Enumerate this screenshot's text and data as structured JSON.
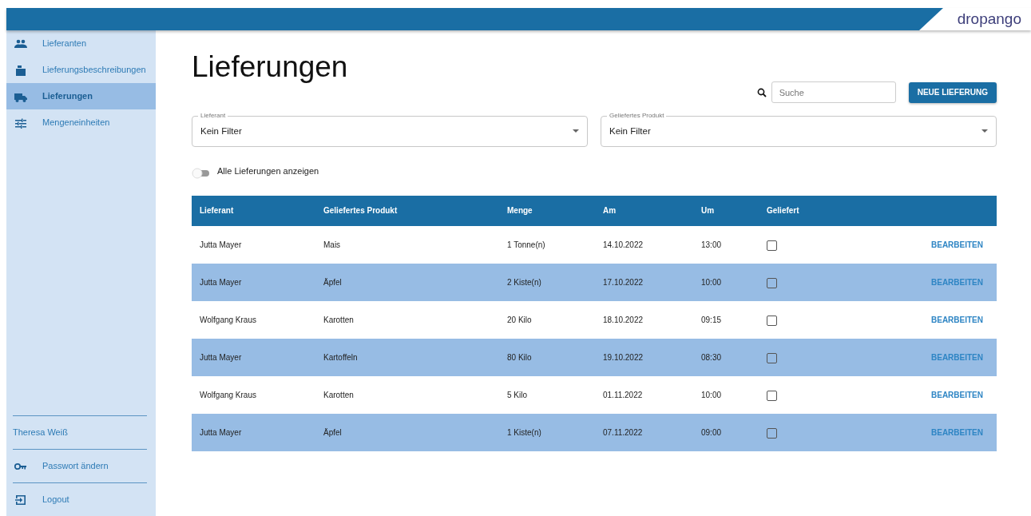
{
  "header": {
    "logo": "dropango"
  },
  "sidebar": {
    "items": [
      {
        "label": "Lieferanten",
        "selected": false
      },
      {
        "label": "Lieferungsbeschreibungen",
        "selected": false
      },
      {
        "label": "Lieferungen",
        "selected": true
      },
      {
        "label": "Mengeneinheiten",
        "selected": false
      }
    ],
    "user": "Theresa Weiß",
    "footer_items": [
      {
        "label": "Passwort ändern"
      },
      {
        "label": "Logout"
      }
    ]
  },
  "page_title": "Lieferungen",
  "search": {
    "placeholder": "Suche"
  },
  "new_button": "NEUE LIEFERUNG",
  "filters": [
    {
      "label": "Lieferant",
      "value": "Kein Filter"
    },
    {
      "label": "Geliefertes Produkt",
      "value": "Kein Filter"
    }
  ],
  "toggle": {
    "label": "Alle Lieferungen anzeigen",
    "on": false
  },
  "table": {
    "columns": [
      "Lieferant",
      "Geliefertes Produkt",
      "Menge",
      "Am",
      "Um",
      "Geliefert"
    ],
    "rows": [
      {
        "cells": [
          "Jutta Mayer",
          "Mais",
          "1 Tonne(n)",
          "14.10.2022",
          "13:00"
        ],
        "delivered": false,
        "action": "BEARBEITEN"
      },
      {
        "cells": [
          "Jutta Mayer",
          "Äpfel",
          "2 Kiste(n)",
          "17.10.2022",
          "10:00"
        ],
        "delivered": false,
        "action": "BEARBEITEN"
      },
      {
        "cells": [
          "Wolfgang Kraus",
          "Karotten",
          "20 Kilo",
          "18.10.2022",
          "09:15"
        ],
        "delivered": false,
        "action": "BEARBEITEN"
      },
      {
        "cells": [
          "Jutta Mayer",
          "Kartoffeln",
          "80 Kilo",
          "19.10.2022",
          "08:30"
        ],
        "delivered": false,
        "action": "BEARBEITEN"
      },
      {
        "cells": [
          "Wolfgang Kraus",
          "Karotten",
          "5 Kilo",
          "01.11.2022",
          "10:00"
        ],
        "delivered": false,
        "action": "BEARBEITEN"
      },
      {
        "cells": [
          "Jutta Mayer",
          "Äpfel",
          "1 Kiste(n)",
          "07.11.2022",
          "09:00"
        ],
        "delivered": false,
        "action": "BEARBEITEN"
      }
    ]
  }
}
